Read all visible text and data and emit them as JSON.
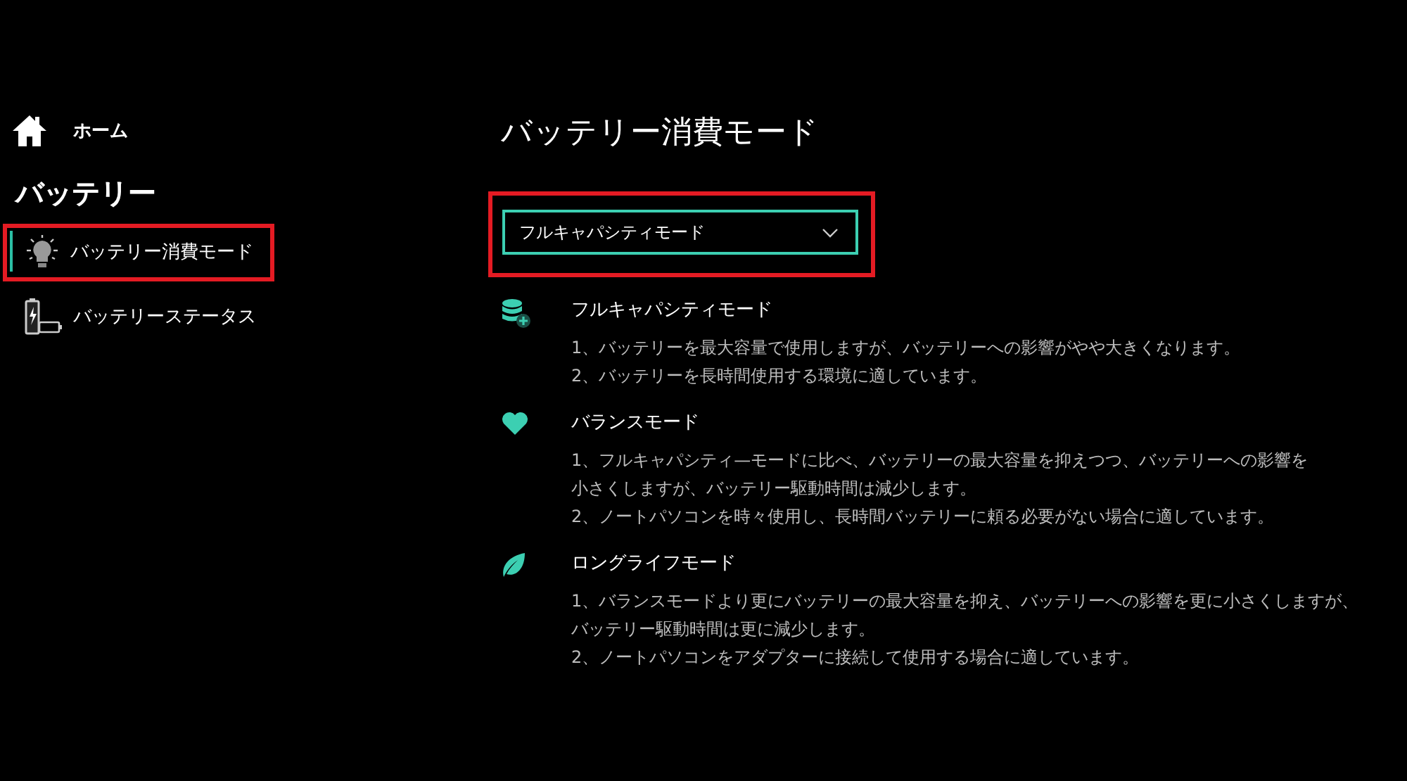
{
  "sidebar": {
    "home": {
      "label": "ホーム"
    },
    "heading": "バッテリー",
    "items": [
      {
        "label": "バッテリー消費モード",
        "selected": true,
        "highlighted": true
      },
      {
        "label": "バッテリーステータス",
        "selected": false,
        "highlighted": false
      }
    ]
  },
  "content": {
    "title": "バッテリー消費モード",
    "dropdown": {
      "value": "フルキャパシティモード",
      "highlighted": true
    },
    "modes": [
      {
        "title": "フルキャパシティモード",
        "lines": [
          "1、バッテリーを最大容量で使用しますが、バッテリーへの影響がやや大きくなります。",
          "2、バッテリーを長時間使用する環境に適しています。"
        ]
      },
      {
        "title": "バランスモード",
        "lines": [
          "1、フルキャパシティ—モードに比べ、バッテリーの最大容量を抑えつつ、バッテリーへの影響を",
          "小さくしますが、バッテリー駆動時間は減少します。",
          "2、ノートパソコンを時々使用し、長時間バッテリーに頼る必要がない場合に適しています。"
        ]
      },
      {
        "title": "ロングライフモード",
        "lines": [
          "1、バランスモードより更にバッテリーの最大容量を抑え、バッテリーへの影響を更に小さくしますが、",
          "バッテリー駆動時間は更に減少します。",
          "2、ノートパソコンをアダプターに接続して使用する場合に適しています。"
        ]
      }
    ]
  }
}
